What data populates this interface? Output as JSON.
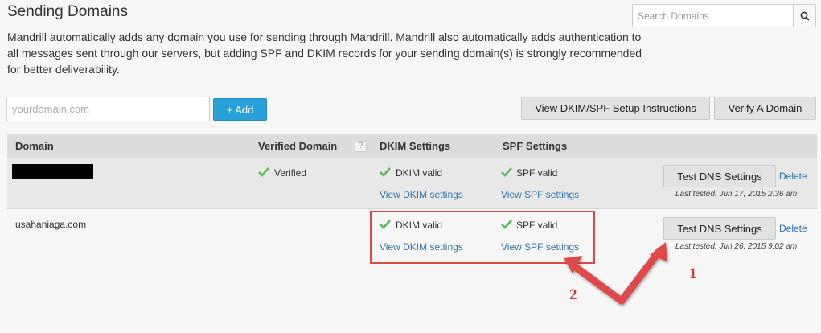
{
  "page": {
    "title": "Sending Domains"
  },
  "search": {
    "placeholder": "Search Domains"
  },
  "description": "Mandrill automatically adds any domain you use for sending through Mandrill. Mandrill also automatically adds authentication to all messages sent through our servers, but adding SPF and DKIM records for your sending domain(s) is strongly recommended for better deliverability.",
  "add_form": {
    "placeholder": "yourdomain.com",
    "add_label": "+ Add"
  },
  "actions": {
    "instructions_label": "View DKIM/SPF Setup Instructions",
    "verify_label": "Verify A Domain"
  },
  "table": {
    "headers": {
      "domain": "Domain",
      "verified": "Verified Domain",
      "help": "?",
      "dkim": "DKIM Settings",
      "spf": "SPF Settings"
    },
    "rows": [
      {
        "domain": "",
        "verified": "Verified",
        "dkim_status": "DKIM valid",
        "dkim_link": "View DKIM settings",
        "spf_status": "SPF valid",
        "spf_link": "View SPF settings",
        "test_label": "Test DNS Settings",
        "delete_label": "Delete",
        "last_tested": "Last tested: Jun 17, 2015 2:36 am"
      },
      {
        "domain": "usahaniaga.com",
        "verified": "",
        "dkim_status": "DKIM valid",
        "dkim_link": "View DKIM settings",
        "spf_status": "SPF valid",
        "spf_link": "View SPF settings",
        "test_label": "Test DNS Settings",
        "delete_label": "Delete",
        "last_tested": "Last tested: Jun 26, 2015 9:02 am"
      }
    ]
  },
  "annotations": {
    "label_1": "1",
    "label_2": "2"
  },
  "icons": {
    "check": "check-icon",
    "search": "search-icon",
    "help": "help-icon"
  },
  "colors": {
    "accent": "#2aa0d8",
    "check": "#5cb85c",
    "link": "#2e73b0",
    "annotation": "#e04848"
  }
}
